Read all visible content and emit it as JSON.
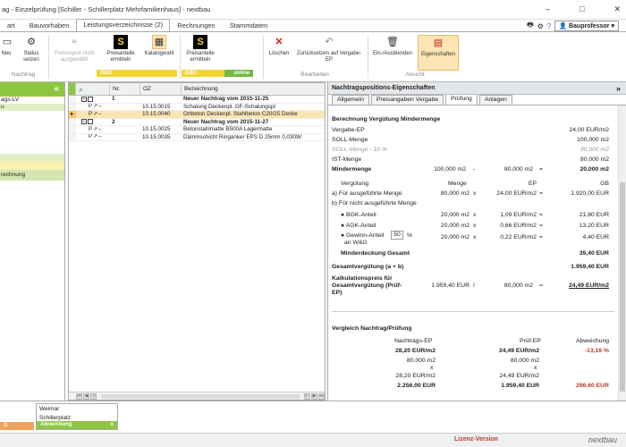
{
  "window": {
    "title": "ag - Einzelprüfung [Schiller - Schillerplatz Mehrfamilienhaus] - nextbau",
    "min": "–",
    "max": "□",
    "close": "✕"
  },
  "menu": {
    "tabs": [
      "art",
      "Bauvorhaben",
      "Leistungsverzeichnisse (2)",
      "Rechnungen",
      "Stammdaten"
    ],
    "user": "Bauprofessor"
  },
  "ribbon": {
    "btn_neu": "Neu",
    "btn_status": "Status setzen",
    "group_nachtrag": "Nachtrag",
    "btn_preisregion": "Preisregion nicht ausgewählt",
    "btn_preisanteile": "Preisanteile ermitteln",
    "btn_katalogwahl": "Katalogwahl",
    "btn_preisanteile2": "Preisanteile ermitteln",
    "dbd_label": "DBD",
    "dbd_online": "online",
    "btn_loeschen": "Löschen",
    "btn_zuruecksetzen": "Zurücksetzen auf Vergabe-EP",
    "group_bearbeiten": "Bearbeiten",
    "btn_einausblenden": "Ein-/Ausblenden",
    "btn_eigenschaften": "Eigenschaften",
    "group_ansicht": "Ansicht"
  },
  "left": {
    "rows": [
      "ags-LV",
      "u",
      "",
      "",
      "",
      "",
      "",
      "",
      "",
      "rechnung"
    ]
  },
  "grid": {
    "headers": [
      "Nr.",
      "OZ",
      "Bezeichnung"
    ],
    "rows": [
      {
        "nr": "1",
        "oz": "",
        "text": "Neuer Nachtrag vom 2015-11-25",
        "bold": true,
        "sel": false
      },
      {
        "nr": "",
        "oz": "10.15.0015",
        "text": "Schalung Deckenpl. GF-Schalungspl",
        "bold": false,
        "sel": false
      },
      {
        "nr": "",
        "oz": "10.15.0040",
        "text": "Ortbeton Deckenpl. Stahlbeton C20/25 Decke",
        "bold": false,
        "sel": true
      },
      {
        "nr": "2",
        "oz": "",
        "text": "Neuer Nachtrag vom 2015-11-27",
        "bold": true,
        "sel": false
      },
      {
        "nr": "",
        "oz": "10.15.0025",
        "text": "Betonstahlmatte B500A Lagermatte",
        "bold": false,
        "sel": false
      },
      {
        "nr": "",
        "oz": "10.15.0035",
        "text": "Dämmschicht Ringanker EPS D 25mm 0,030W",
        "bold": false,
        "sel": false
      }
    ]
  },
  "props": {
    "title": "Nachtragspositions-Eigenschaften",
    "tabs": [
      "Allgemein",
      "Preisangaben Vergabe",
      "Prüfung",
      "Anlagen"
    ],
    "section1": "Berechnung Vergütung Mindermenge",
    "vergabe_ep_label": "Vergabe-EP",
    "vergabe_ep": "24,00 EUR/m2",
    "soll_label": "SOLL-Menge",
    "soll": "100,000 m2",
    "soll10_label": "SOLL-Menge - 10 %",
    "soll10": "90,000 m2",
    "ist_label": "IST-Menge",
    "ist": "80,000 m2",
    "minder_label": "Mindermenge",
    "minder_a": "100,000 m2",
    "minus": "-",
    "minder_b": "80,000 m2",
    "eq": "=",
    "minder_c": "20,000 m2",
    "col_verg": "Vergütung",
    "col_menge": "Menge",
    "col_ep": "EP",
    "col_gb": "GB",
    "a_label": "a) Für ausgeführte Menge",
    "a_menge": "80,000 m2",
    "x": "x",
    "a_ep": "24,00 EUR/m2",
    "a_gb": "1.920,00 EUR",
    "b_label": "b) Für nicht ausgeführte Menge",
    "bgk_label": "BGK-Anteil",
    "bgk_menge": "20,000 m2",
    "bgk_ep": "1,09 EUR/m2",
    "bgk_gb": "21,80 EUR",
    "agk_label": "AGK-Anteil",
    "agk_menge": "20,000 m2",
    "agk_ep": "0,66 EUR/m2",
    "agk_gb": "13,20 EUR",
    "gew_label": "Gewinn-Anteil",
    "gew_pct": "50",
    "pct": "%",
    "gew_label2": "an W&G",
    "gew_menge": "20,000 m2",
    "gew_ep": "0,22 EUR/m2",
    "gew_gb": "4,40 EUR",
    "minderdeckung_label": "Minderdeckung Gesamt",
    "minderdeckung": "39,40 EUR",
    "gesamt_label": "Gesamtvergütung (a + b)",
    "gesamt": "1.959,40 EUR",
    "kalk_label1": "Kalkulationspreis für",
    "kalk_label2": "Gesamtvergütung (Prüf-",
    "kalk_label3": "EP)",
    "kalk_a": "1.959,40 EUR",
    "slash": "/",
    "kalk_b": "80,000 m2",
    "kalk_c": "24,49 EUR/m2",
    "section2": "Vergleich Nachtrag/Prüfung",
    "v_col1": "Nachtrags-EP",
    "v_col2": "Prüf-EP",
    "v_col3": "Abweichung",
    "v_ep1": "28,20 EUR/m2",
    "v_ep2": "24,49 EUR/m2",
    "v_abw": "-13,16 %",
    "v_m1": "80,000 m2",
    "v_m2": "80,000 m2",
    "v_x": "x",
    "v_ep1b": "28,20 EUR/m2",
    "v_ep2b": "24,49 EUR/m2",
    "v_g1": "2.256,00 EUR",
    "v_g2": "1.959,40 EUR",
    "v_g3": "296,60 EUR"
  },
  "bottom": {
    "tab1_bar": "G",
    "tab2_line1": "Weimar",
    "tab2_line2": "Schillerplatz Mehrfamilienhau",
    "tab2_bar": "Abrechnung",
    "tab2_close": "x"
  },
  "status": {
    "lizenz": "Lizenz-Version",
    "logo": "nextbau"
  },
  "colors": {
    "green": "#8ec641",
    "selection": "#fbe4b4",
    "red": "#c0392b",
    "dbd_yellow": "#f3d331"
  }
}
